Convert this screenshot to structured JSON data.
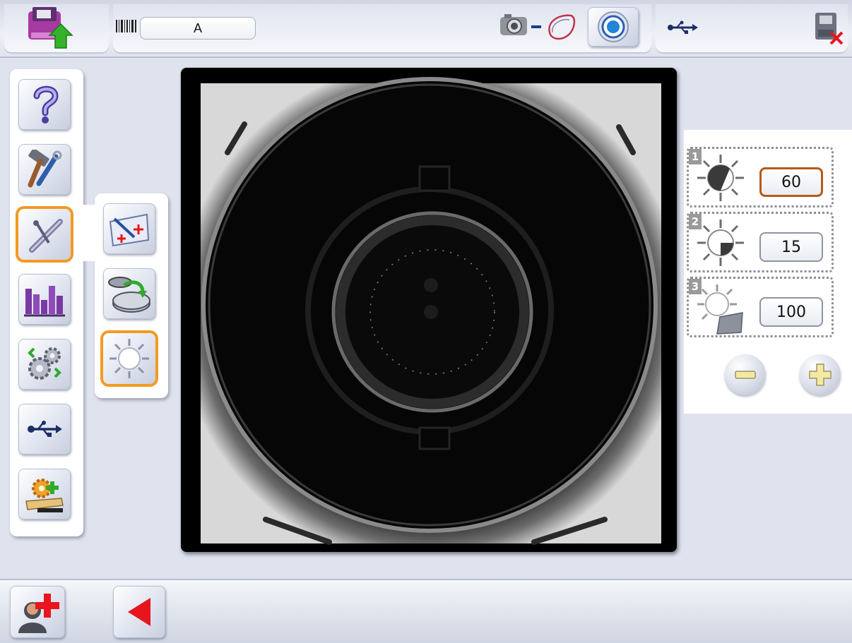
{
  "topbar": {
    "job_code": "A",
    "icons": {
      "upload": "upload-job-icon",
      "barcode": "barcode-icon",
      "camera": "camera-icon",
      "lens_shape": "lens-shape-icon",
      "target": "target-icon",
      "usb": "usb-icon",
      "exit": "exit-terminal-icon"
    }
  },
  "sidebar": {
    "items": [
      {
        "icon": "help-icon"
      },
      {
        "icon": "tools-icon"
      },
      {
        "icon": "calibration-icon",
        "selected": true
      },
      {
        "icon": "statistics-icon"
      },
      {
        "icon": "settings-gears-icon"
      },
      {
        "icon": "usb-icon"
      },
      {
        "icon": "add-settings-icon"
      }
    ]
  },
  "submenu": {
    "items": [
      {
        "icon": "crosshair-calibration-icon"
      },
      {
        "icon": "lens-rotation-icon"
      },
      {
        "icon": "brightness-icon",
        "selected": true
      }
    ]
  },
  "lighting": {
    "rows": [
      {
        "number": "1",
        "value": "60",
        "icon": "brightness-half-icon",
        "active": true
      },
      {
        "number": "2",
        "value": "15",
        "icon": "brightness-quarter-icon",
        "active": false
      },
      {
        "number": "3",
        "value": "100",
        "icon": "brightness-surface-icon",
        "active": false
      }
    ],
    "minus_icon": "minus-icon",
    "plus_icon": "plus-icon"
  },
  "bottombar": {
    "icons": {
      "operator": "add-operator-icon",
      "back": "back-arrow-icon"
    }
  },
  "colors": {
    "selection": "#f29a22",
    "active_value_border": "#b55a18",
    "back_arrow": "#e8141e",
    "plus_cross": "#e8141e",
    "minus_plus_fill": "#f3e9a0"
  }
}
